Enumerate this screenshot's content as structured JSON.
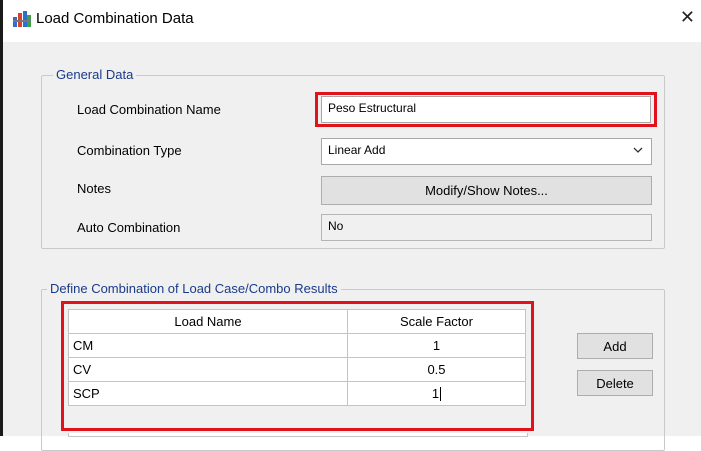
{
  "window": {
    "title": "Load Combination Data",
    "close_glyph": "✕"
  },
  "general": {
    "group_title": "General Data",
    "name_label": "Load Combination Name",
    "name_value": "Peso Estructural",
    "type_label": "Combination Type",
    "type_value": "Linear Add",
    "notes_label": "Notes",
    "notes_button": "Modify/Show Notes...",
    "auto_label": "Auto Combination",
    "auto_value": "No"
  },
  "define": {
    "group_title": "Define Combination of Load Case/Combo Results",
    "columns": [
      "Load Name",
      "Scale Factor"
    ],
    "rows": [
      {
        "name": "CM",
        "scale": "1"
      },
      {
        "name": "CV",
        "scale": "0.5"
      },
      {
        "name": "SCP",
        "scale": "1"
      }
    ],
    "add_button": "Add",
    "delete_button": "Delete"
  },
  "colors": {
    "highlight": "#e0121b",
    "group_title": "#1a3a8a",
    "dialog_bg": "#f0f0f0"
  },
  "icons": {
    "app": "etabs-app-icon",
    "dropdown": "chevron-down-icon",
    "close": "close-icon"
  }
}
